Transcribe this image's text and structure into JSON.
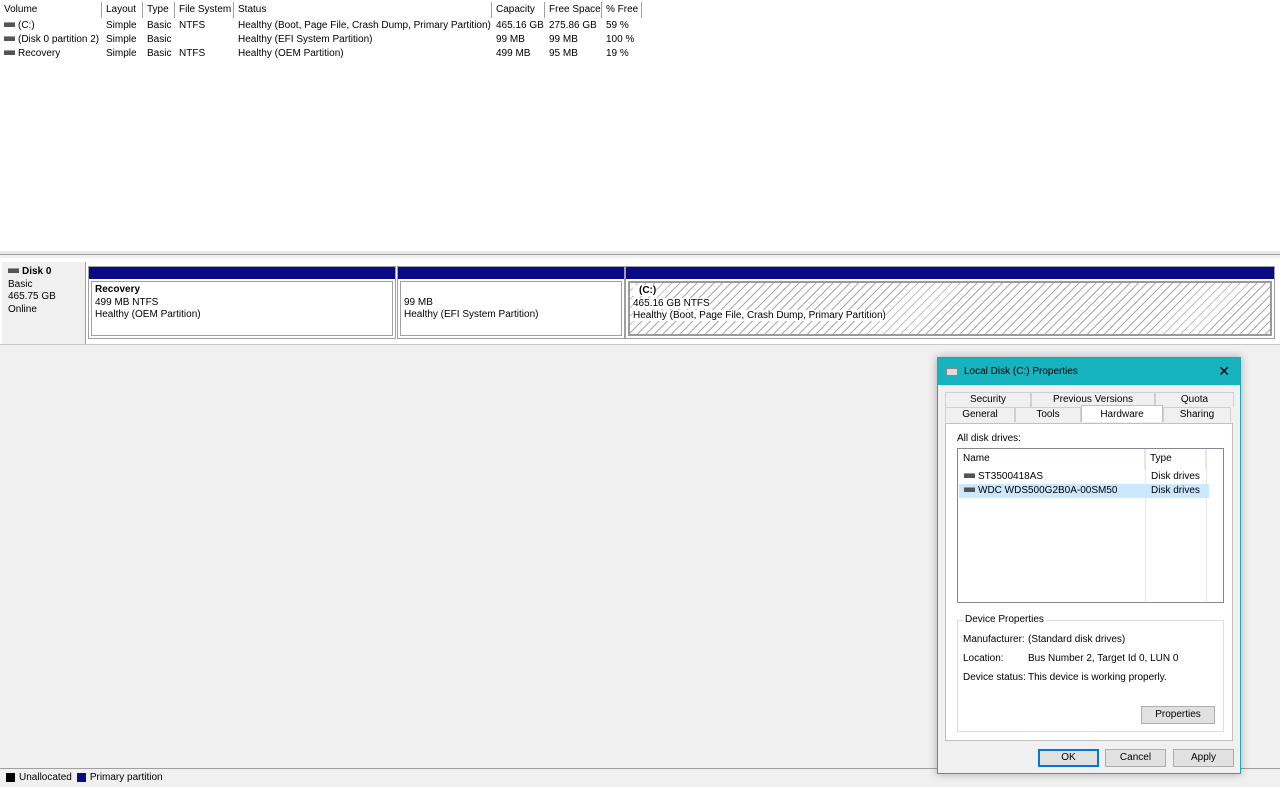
{
  "volume_list": {
    "columns": [
      "Volume",
      "Layout",
      "Type",
      "File System",
      "Status",
      "Capacity",
      "Free Space",
      "% Free"
    ],
    "rows": [
      {
        "volume": "(C:)",
        "layout": "Simple",
        "type": "Basic",
        "fs": "NTFS",
        "status": "Healthy (Boot, Page File, Crash Dump, Primary Partition)",
        "capacity": "465.16 GB",
        "free": "275.86 GB",
        "pct": "59 %"
      },
      {
        "volume": "(Disk 0 partition 2)",
        "layout": "Simple",
        "type": "Basic",
        "fs": "",
        "status": "Healthy (EFI System Partition)",
        "capacity": "99 MB",
        "free": "99 MB",
        "pct": "100 %"
      },
      {
        "volume": "Recovery",
        "layout": "Simple",
        "type": "Basic",
        "fs": "NTFS",
        "status": "Healthy (OEM Partition)",
        "capacity": "499 MB",
        "free": "95 MB",
        "pct": "19 %"
      }
    ]
  },
  "disk": {
    "name": "Disk 0",
    "kind": "Basic",
    "size": "465.75 GB",
    "state": "Online",
    "partitions": [
      {
        "title": "Recovery",
        "line1": "499 MB NTFS",
        "line2": "Healthy (OEM Partition)"
      },
      {
        "title": "",
        "line1": "99 MB",
        "line2": "Healthy (EFI System Partition)"
      },
      {
        "title": "(C:)",
        "line1": "465.16 GB NTFS",
        "line2": "Healthy (Boot, Page File, Crash Dump, Primary Partition)"
      }
    ]
  },
  "legend": {
    "unallocated": "Unallocated",
    "primary": "Primary partition",
    "unallocated_color": "#000000",
    "primary_color": "#0a0a84"
  },
  "dialog": {
    "title": "Local Disk (C:) Properties",
    "close": "✕",
    "tabs_top": [
      "Security",
      "Previous Versions",
      "Quota"
    ],
    "tabs_bottom": [
      "General",
      "Tools",
      "Hardware",
      "Sharing"
    ],
    "active_tab": "Hardware",
    "all_disk_drives": "All disk drives:",
    "list_headers": {
      "name": "Name",
      "type": "Type"
    },
    "drives": [
      {
        "name": "ST3500418AS",
        "type": "Disk drives"
      },
      {
        "name": "WDC  WDS500G2B0A-00SM50",
        "type": "Disk drives"
      }
    ],
    "device_properties": {
      "legend": "Device Properties",
      "manufacturer_label": "Manufacturer:",
      "manufacturer": "(Standard disk drives)",
      "location_label": "Location:",
      "location": "Bus Number 2, Target Id 0, LUN 0",
      "status_label": "Device status:",
      "status": "This device is working properly.",
      "properties_button": "Properties"
    },
    "buttons": {
      "ok": "OK",
      "cancel": "Cancel",
      "apply": "Apply"
    },
    "accent_color": "#17b3bf"
  }
}
